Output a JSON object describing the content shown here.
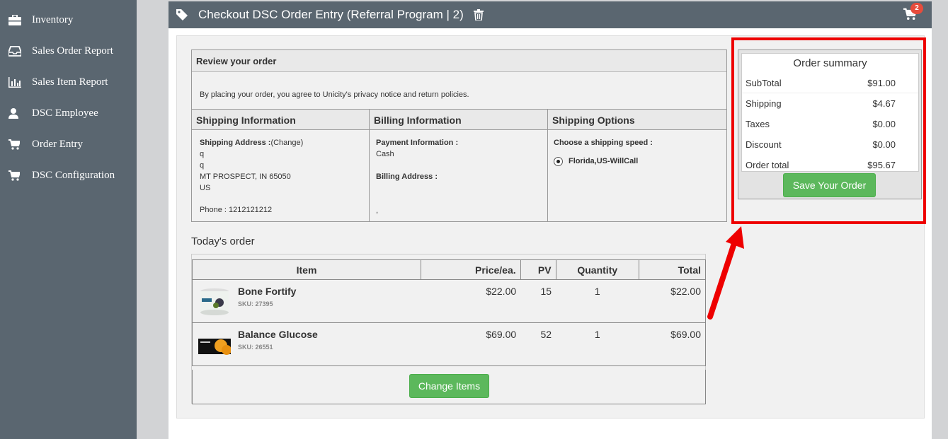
{
  "sidebar": {
    "items": [
      {
        "label": "Inventory",
        "icon": "briefcase-icon"
      },
      {
        "label": "Sales Order Report",
        "icon": "inbox-icon"
      },
      {
        "label": "Sales Item Report",
        "icon": "bar-chart-icon"
      },
      {
        "label": "DSC Employee",
        "icon": "user-icon"
      },
      {
        "label": "Order Entry",
        "icon": "cart-icon"
      },
      {
        "label": "DSC Configuration",
        "icon": "cart-icon"
      }
    ]
  },
  "header": {
    "title": "Checkout DSC Order Entry (Referral Program | 2)",
    "cart_count": "2"
  },
  "review": {
    "title": "Review your order",
    "notice": "By placing your order, you agree to Unicity's privacy notice and return policies.",
    "shipping_info": {
      "heading": "Shipping Information",
      "address_label": "Shipping Address :",
      "change_link": "(Change)",
      "line1": "q",
      "line2": "q",
      "city_line": "MT PROSPECT, IN 65050",
      "country": "US",
      "phone": "Phone : 1212121212"
    },
    "billing_info": {
      "heading": "Billing Information",
      "payment_label": "Payment Information :",
      "payment_value": "Cash",
      "billing_address_label": "Billing Address :",
      "billing_address_value": ","
    },
    "shipping_options": {
      "heading": "Shipping Options",
      "choose_label": "Choose a shipping speed :",
      "selected_option": "Florida,US-WillCall"
    }
  },
  "today": {
    "title": "Today's order",
    "columns": [
      "Item",
      "Price/ea.",
      "PV",
      "Quantity",
      "Total"
    ],
    "rows": [
      {
        "name": "Bone Fortify",
        "sku": "SKU: 27395",
        "price": "$22.00",
        "pv": "15",
        "qty": "1",
        "total": "$22.00"
      },
      {
        "name": "Balance Glucose",
        "sku": "SKU: 26551",
        "price": "$69.00",
        "pv": "52",
        "qty": "1",
        "total": "$69.00"
      }
    ],
    "change_items_label": "Change Items"
  },
  "summary": {
    "title": "Order summary",
    "subtotal_label": "SubTotal",
    "subtotal": "$91.00",
    "shipping_label": "Shipping",
    "shipping": "$4.67",
    "taxes_label": "Taxes",
    "taxes": "$0.00",
    "discount_label": "Discount",
    "discount": "$0.00",
    "total_label": "Order total",
    "total": "$95.67",
    "save_label": "Save Your Order"
  },
  "colors": {
    "sidebar": "#5a6670",
    "button_green": "#5cb85c",
    "annotation_red": "#e00000",
    "badge_red": "#e74c3c"
  }
}
